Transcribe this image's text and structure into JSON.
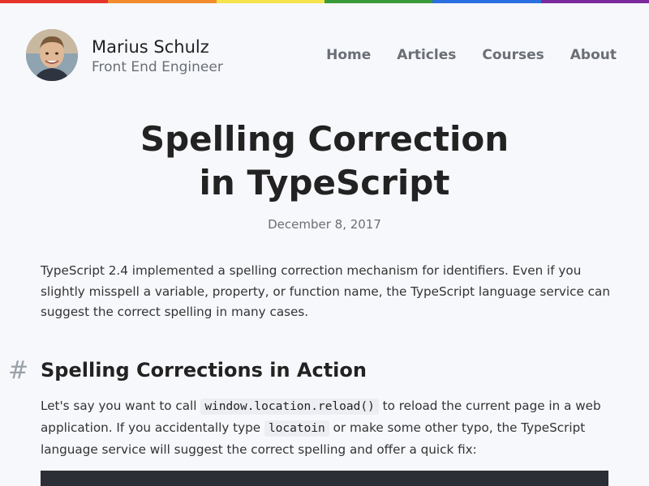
{
  "rainbow_colors": [
    "#e5342b",
    "#f28c2c",
    "#f7e34b",
    "#3a9a3a",
    "#2a6fe0",
    "#7a2a9a"
  ],
  "author": {
    "name": "Marius Schulz",
    "role": "Front End Engineer",
    "avatar_icon": "author-avatar"
  },
  "nav": {
    "items": [
      {
        "label": "Home"
      },
      {
        "label": "Articles"
      },
      {
        "label": "Courses"
      },
      {
        "label": "About"
      }
    ]
  },
  "article": {
    "title_line1": "Spelling Correction",
    "title_line2": "in TypeScript",
    "date": "December 8, 2017",
    "intro": "TypeScript 2.4 implemented a spelling correction mechanism for identifiers. Even if you slightly misspell a variable, property, or function name, the TypeScript language service can suggest the correct spelling in many cases.",
    "section": {
      "hash": "#",
      "heading": "Spelling Corrections in Action",
      "para_part1": "Let's say you want to call ",
      "code1": "window.location.reload()",
      "para_part2": " to reload the current page in a web application. If you accidentally type ",
      "code2": "locatoin",
      "para_part3": " or make some other typo, the TypeScript language service will suggest the correct spelling and offer a quick fix:"
    }
  }
}
